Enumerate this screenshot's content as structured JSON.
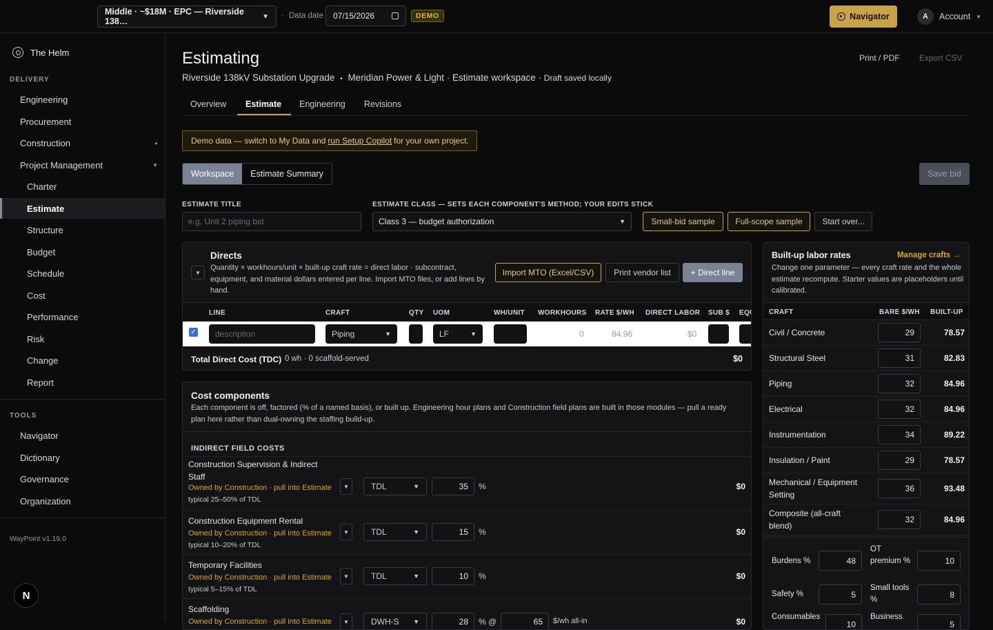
{
  "topbar": {
    "project": "Middle · ~$18M · EPC — Riverside 138…",
    "dot": "·",
    "data_date_label": "Data date",
    "data_date": "07/15/2026",
    "demo_badge": "DEMO",
    "navigator": "Navigator",
    "avatar_letter": "A",
    "account": "Account"
  },
  "sidebar": {
    "home": "The Helm",
    "delivery_label": "DELIVERY",
    "delivery": [
      {
        "label": "Engineering"
      },
      {
        "label": "Procurement"
      },
      {
        "label": "Construction"
      },
      {
        "label": "Project Management"
      }
    ],
    "pm_children": [
      "Charter",
      "Estimate",
      "Structure",
      "Budget",
      "Schedule",
      "Cost",
      "Performance",
      "Risk",
      "Change",
      "Report"
    ],
    "tools_label": "TOOLS",
    "tools": [
      "Navigator",
      "Dictionary",
      "Governance",
      "Organization"
    ],
    "version": "WayPoint v1.19.0",
    "n_badge": "N"
  },
  "header": {
    "title": "Estimating",
    "project_name": "Riverside 138kV Substation Upgrade",
    "bullet": "•",
    "client": "Meridian Power & Light · Estimate workspace · ",
    "draft": "Draft saved locally",
    "print_pdf": "Print / PDF",
    "export_csv": "Export CSV"
  },
  "tabs": [
    "Overview",
    "Estimate",
    "Engineering",
    "Revisions"
  ],
  "demo_note": {
    "pre": "Demo data — switch to My Data and",
    "link": "run Setup Copilot",
    "post": "for your own project."
  },
  "view_toggle": {
    "workspace": "Workspace",
    "summary": "Estimate Summary"
  },
  "save_bid": "Save bid",
  "estimate_title": {
    "label": "ESTIMATE TITLE",
    "placeholder": "e.g. Unit 2 piping bid"
  },
  "estimate_class": {
    "label": "ESTIMATE CLASS — SETS EACH COMPONENT'S METHOD; YOUR EDITS STICK",
    "value": "Class 3 — budget authorization"
  },
  "sample_buttons": {
    "small": "Small-bid sample",
    "full": "Full-scope sample",
    "start_over": "Start over..."
  },
  "directs": {
    "title": "Directs",
    "desc": "Quantity × workhours/unit × built-up craft rate = direct labor · subcontract, equipment, and material dollars entered per line. Import MTO files, or add lines by hand.",
    "import": "Import MTO (Excel/CSV)",
    "print_vendor": "Print vendor list",
    "add_line": "+ Direct line",
    "columns": [
      "LINE",
      "CRAFT",
      "QTY",
      "UOM",
      "WH/UNIT",
      "WORKHOURS",
      "RATE $/WH",
      "DIRECT LABOR",
      "SUB $",
      "EQU"
    ],
    "row": {
      "checked": "✓",
      "description_placeholder": "description",
      "craft": "Piping",
      "uom": "LF",
      "workhours": "0",
      "rate": "84.96",
      "direct_labor": "$0"
    },
    "tdc_label": "Total Direct Cost (TDC)",
    "tdc_sub": "0 wh · 0 scaffold-served",
    "tdc_value": "$0"
  },
  "cost_components": {
    "title": "Cost components",
    "desc": "Each component is off, factored (% of a named basis), or built up. Engineering hour plans and Construction field plans are built in those modules — pull a ready plan here rather than dual-owning the staffing build-up.",
    "section": "INDIRECT FIELD COSTS",
    "rows": [
      {
        "name": "Construction Supervision & Indirect Staff",
        "owned": "Owned by Construction · pull into Estimate",
        "typical": "typical 25–50% of TDL",
        "basis": "TDL",
        "value": "35",
        "unit": "%",
        "amount": "$0"
      },
      {
        "name": "Construction Equipment Rental",
        "owned": "Owned by Construction · pull into Estimate",
        "typical": "typical 10–20% of TDL",
        "basis": "TDL",
        "value": "15",
        "unit": "%",
        "amount": "$0"
      },
      {
        "name": "Temporary Facilities",
        "owned": "Owned by Construction · pull into Estimate",
        "typical": "typical 5–15% of TDL",
        "basis": "TDL",
        "value": "10",
        "unit": "%",
        "amount": "$0"
      },
      {
        "name": "Scaffolding",
        "owned": "Owned by Construction · pull into Estimate",
        "typical": "",
        "basis": "DWH-S",
        "value": "28",
        "unit": "% @",
        "rate": "65",
        "rate_unit": "$/wh all-in",
        "amount": "$0"
      }
    ]
  },
  "labor_rates": {
    "title": "Built-up labor rates",
    "manage": "Manage crafts →",
    "desc": "Change one parameter — every craft rate and the whole estimate recompute. Starter values are placeholders until calibrated.",
    "columns": [
      "CRAFT",
      "BARE $/WH",
      "BUILT-UP"
    ],
    "crafts": [
      {
        "name": "Civil / Concrete",
        "bare": "29",
        "built": "78.57"
      },
      {
        "name": "Structural Steel",
        "bare": "31",
        "built": "82.83"
      },
      {
        "name": "Piping",
        "bare": "32",
        "built": "84.96"
      },
      {
        "name": "Electrical",
        "bare": "32",
        "built": "84.96"
      },
      {
        "name": "Instrumentation",
        "bare": "34",
        "built": "89.22"
      },
      {
        "name": "Insulation / Paint",
        "bare": "29",
        "built": "78.57"
      },
      {
        "name": "Mechanical / Equipment Setting",
        "bare": "36",
        "built": "93.48"
      },
      {
        "name": "Composite (all-craft blend)",
        "bare": "32",
        "built": "84.96"
      }
    ],
    "params": [
      {
        "label": "Burdens %",
        "value": "48"
      },
      {
        "label": "OT premium %",
        "value": "10"
      },
      {
        "label": "Safety %",
        "value": "5"
      },
      {
        "label": "Small tools %",
        "value": "8"
      },
      {
        "label": "Consumables",
        "value": "10"
      },
      {
        "label": "Business",
        "value": "5"
      }
    ]
  }
}
